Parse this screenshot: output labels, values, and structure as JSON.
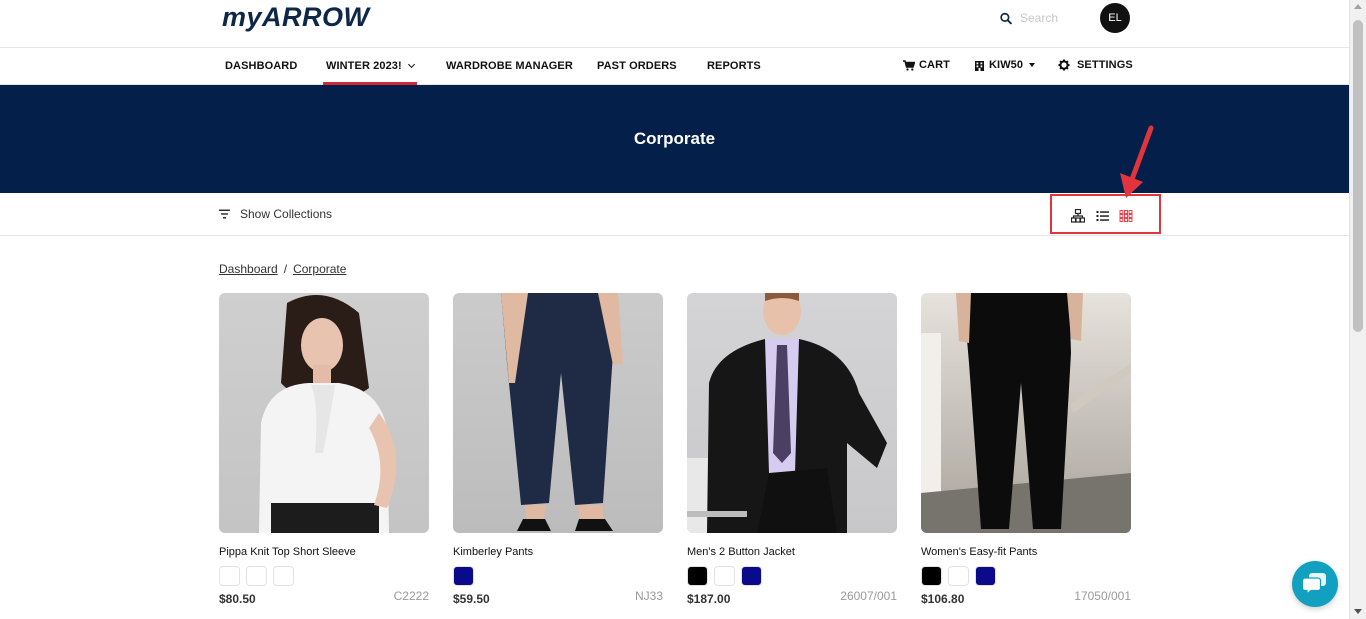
{
  "header": {
    "logo_prefix": "my",
    "logo_brand": "ARROW",
    "search_placeholder": "Search",
    "avatar_initials": "EL"
  },
  "nav": {
    "left": [
      {
        "label": "DASHBOARD"
      },
      {
        "label": "WINTER 2023!"
      },
      {
        "label": "WARDROBE MANAGER"
      },
      {
        "label": "PAST ORDERS"
      },
      {
        "label": "REPORTS"
      }
    ],
    "cart": "CART",
    "account": "KIW50",
    "settings": "SETTINGS"
  },
  "banner": {
    "title": "Corporate"
  },
  "toolbar": {
    "show_collections": "Show Collections"
  },
  "breadcrumb": {
    "home": "Dashboard",
    "separator": "/",
    "current": "Corporate"
  },
  "products": [
    {
      "name": "Pippa Knit Top Short Sleeve",
      "price": "$80.50",
      "sku": "C2222",
      "swatches": [
        "#ffffff",
        "#ffffff",
        "#ffffff"
      ]
    },
    {
      "name": "Kimberley Pants",
      "price": "$59.50",
      "sku": "NJ33",
      "swatches": [
        "#0a0a8a"
      ]
    },
    {
      "name": "Men's 2 Button Jacket",
      "price": "$187.00",
      "sku": "26007/001",
      "swatches": [
        "#000000",
        "#ffffff",
        "#0a0a8a"
      ]
    },
    {
      "name": "Women's Easy-fit Pants",
      "price": "$106.80",
      "sku": "17050/001",
      "swatches": [
        "#000000",
        "#ffffff",
        "#0a0a8a"
      ]
    }
  ],
  "colors": {
    "brand_navy": "#04204a",
    "accent_red": "#d1293a",
    "chat_teal": "#12a0c0"
  }
}
